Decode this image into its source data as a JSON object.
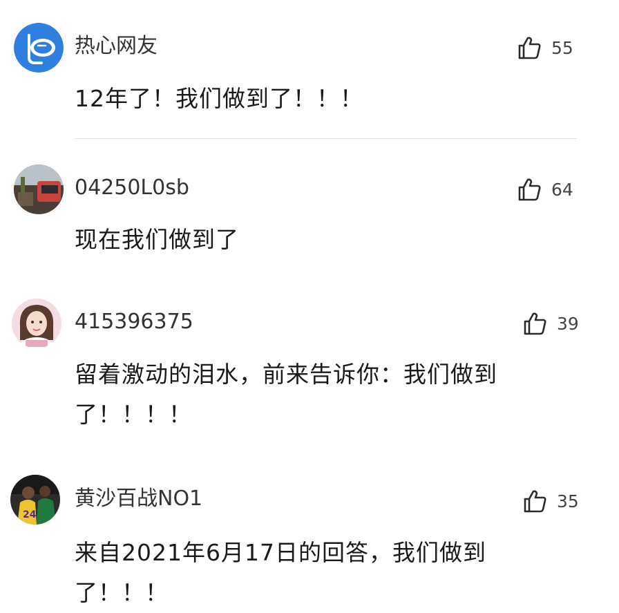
{
  "comments": [
    {
      "username": "热心网友",
      "likes": "55",
      "text": "12年了！我们做到了！！！",
      "avatar_icon": "snorkel-mask-icon"
    },
    {
      "username": "04250L0sb",
      "likes": "64",
      "text": "现在我们做到了",
      "avatar_icon": "user-photo-avatar"
    },
    {
      "username": "415396375",
      "likes": "39",
      "text": "留着激动的泪水，前来告诉你：我们做到了！！！！",
      "avatar_icon": "user-photo-avatar"
    },
    {
      "username": "黄沙百战NO1",
      "likes": "35",
      "text": "来自2021年6月17日的回答，我们做到了！！！",
      "avatar_icon": "user-photo-avatar"
    }
  ],
  "icons": {
    "like": "thumbs-up-icon"
  },
  "colors": {
    "avatar_blue": "#2f7fde",
    "text": "#1a1a1a",
    "divider": "#e2e2e2"
  }
}
